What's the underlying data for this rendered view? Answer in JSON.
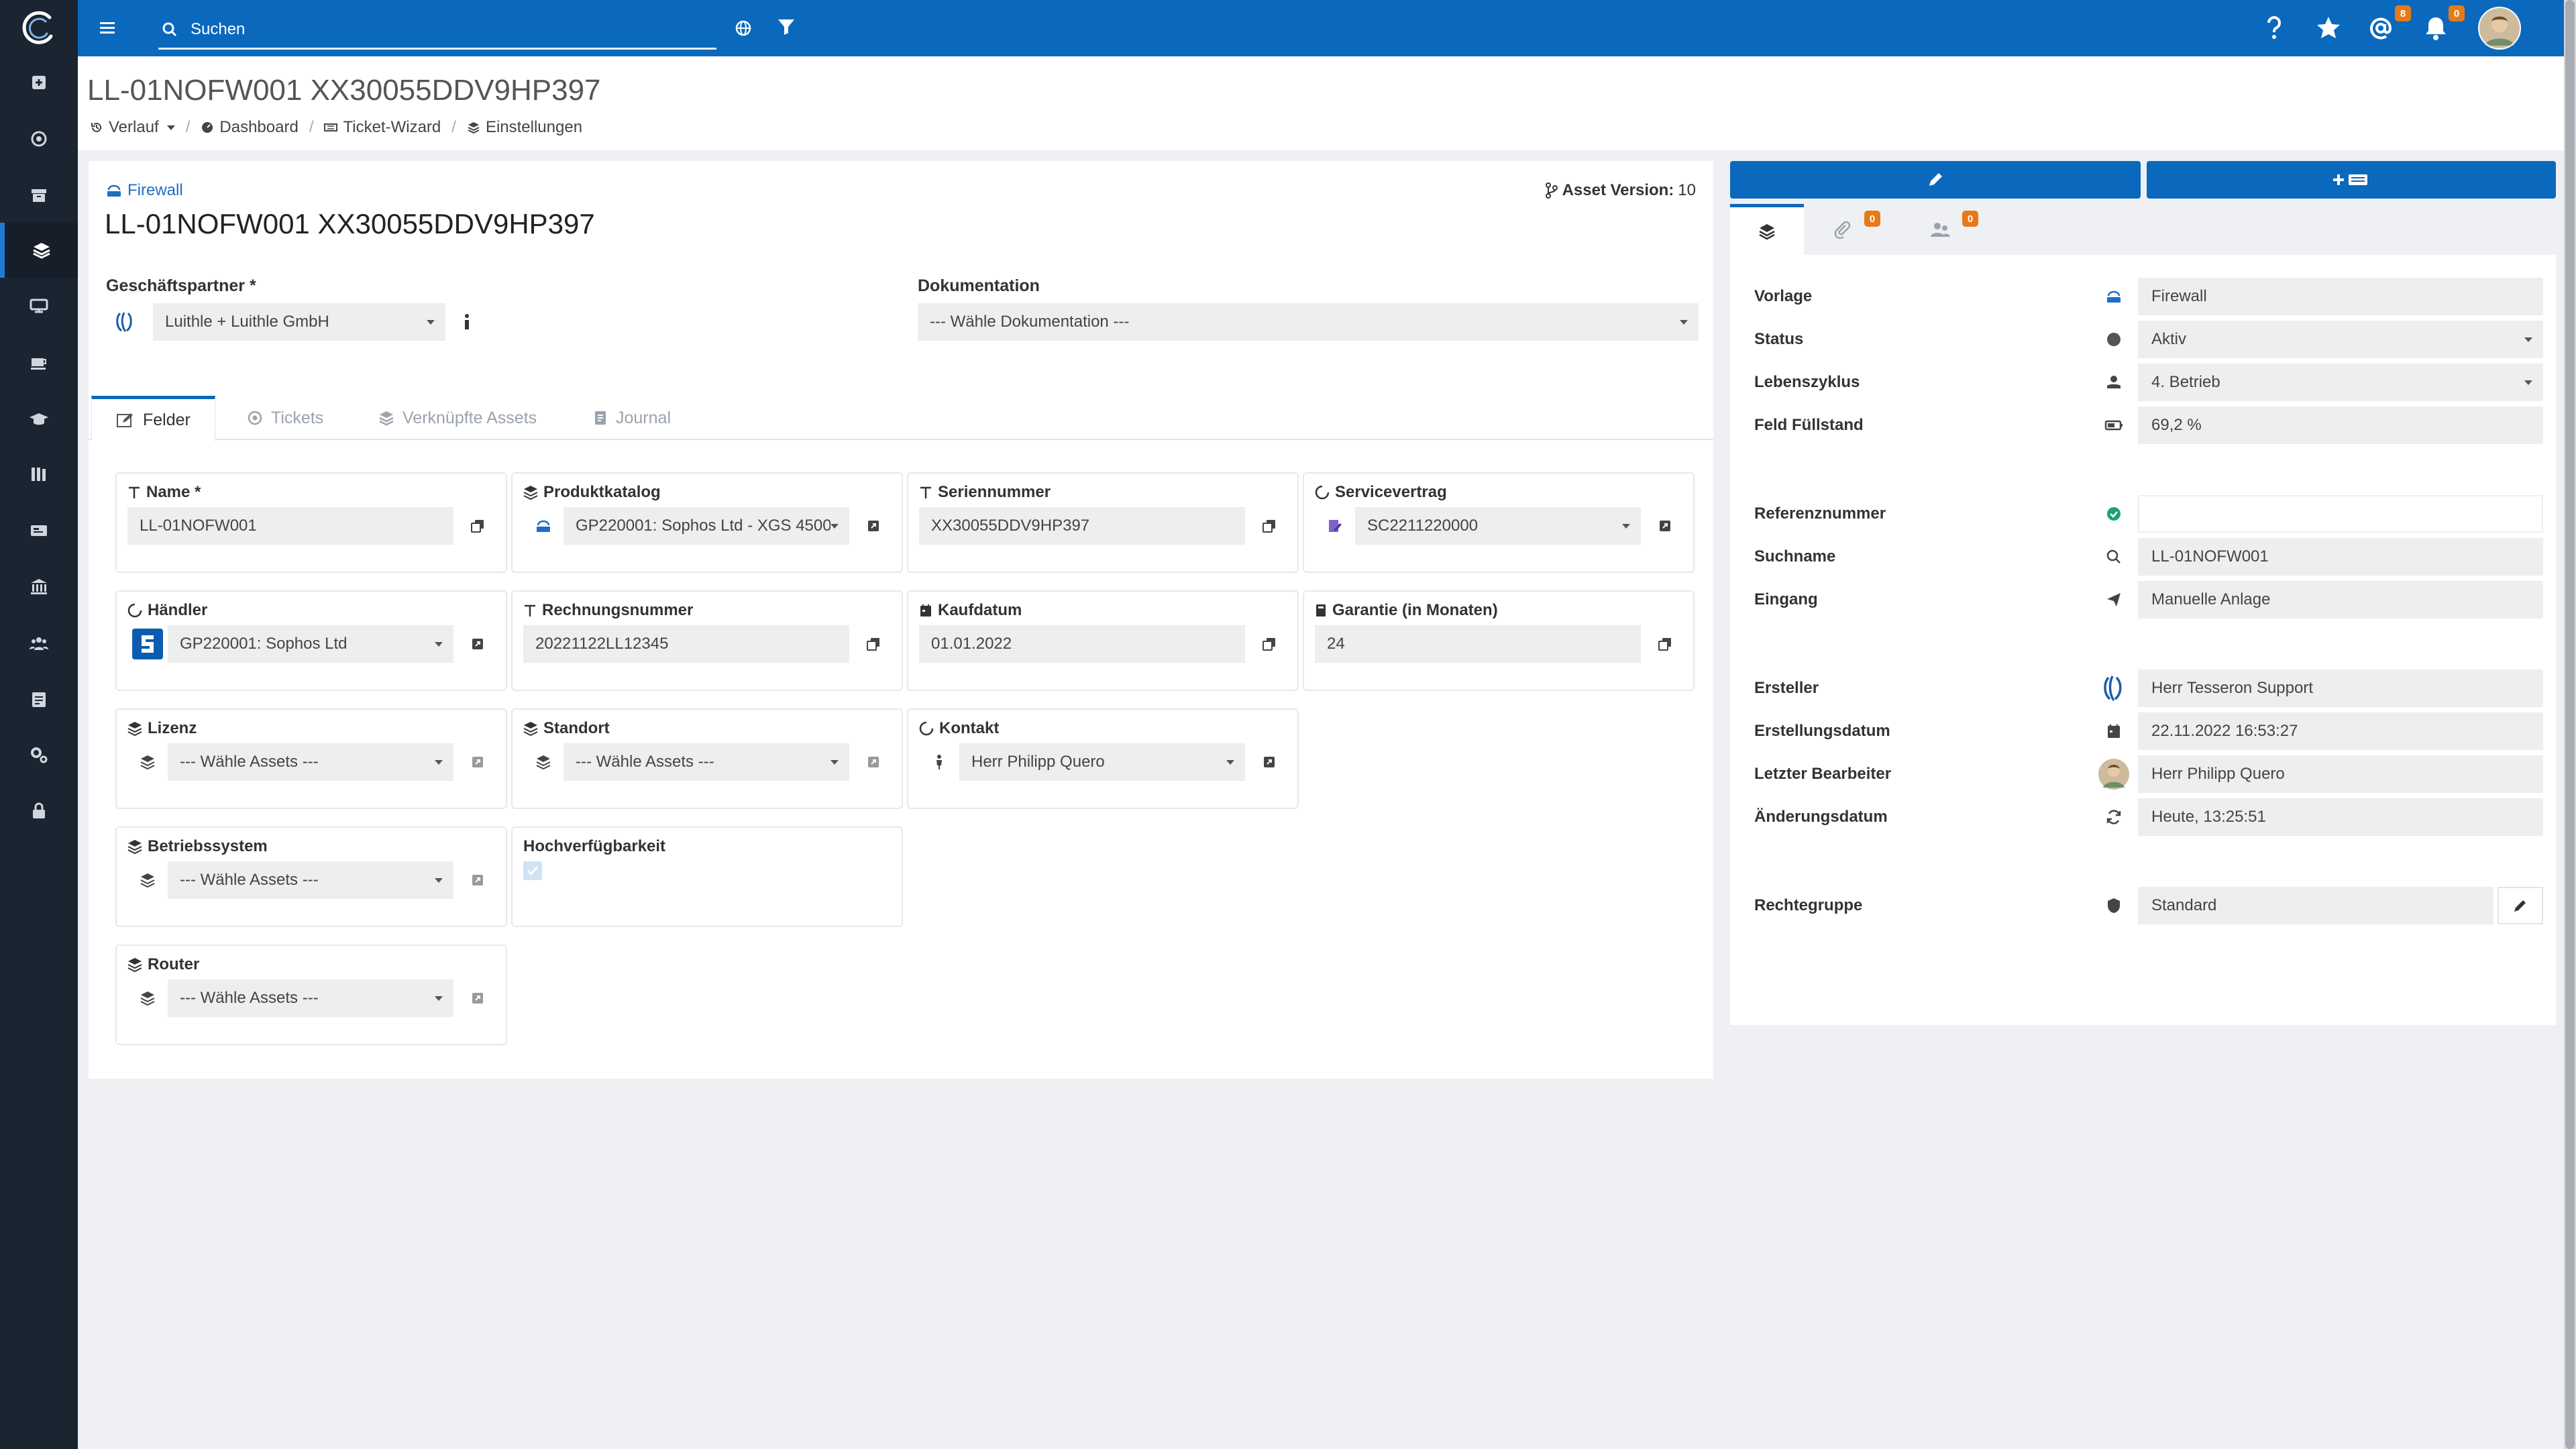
{
  "topbar": {
    "search_placeholder": "Suchen",
    "mentions_count": "8",
    "notifications_count": "0"
  },
  "header": {
    "title": "LL-01NOFW001 XX30055DDV9HP397",
    "breadcrumb": [
      "Verlauf",
      "Dashboard",
      "Ticket-Wizard",
      "Einstellungen"
    ]
  },
  "asset": {
    "type_label": "Firewall",
    "title": "LL-01NOFW001 XX30055DDV9HP397",
    "version_label": "Asset Version:",
    "version_value": "10",
    "partner_label": "Geschäftspartner *",
    "partner_value": "Luithle + Luithle GmbH",
    "doc_label": "Dokumentation",
    "doc_value": "--- Wähle Dokumentation ---"
  },
  "tabs": [
    "Felder",
    "Tickets",
    "Verknüpfte Assets",
    "Journal"
  ],
  "fields": [
    {
      "label": "Name *",
      "value": "LL-01NOFW001"
    },
    {
      "label": "Produktkatalog",
      "value": "GP220001: Sophos Ltd - XGS 4500"
    },
    {
      "label": "Seriennummer",
      "value": "XX30055DDV9HP397"
    },
    {
      "label": "Servicevertrag",
      "value": "SC2211220000"
    },
    {
      "label": "Händler",
      "value": "GP220001: Sophos Ltd"
    },
    {
      "label": "Rechnungsnummer",
      "value": "20221122LL12345"
    },
    {
      "label": "Kaufdatum",
      "value": "01.01.2022"
    },
    {
      "label": "Garantie (in Monaten)",
      "value": "24"
    },
    {
      "label": "Lizenz",
      "value": "--- Wähle Assets ---"
    },
    {
      "label": "Standort",
      "value": "--- Wähle Assets ---"
    },
    {
      "label": "Kontakt",
      "value": "Herr Philipp Quero"
    },
    {
      "label": "Betriebssystem",
      "value": "--- Wähle Assets ---"
    },
    {
      "label": "Hochverfügbarkeit",
      "value": ""
    },
    {
      "label": "Router",
      "value": "--- Wähle Assets ---"
    }
  ],
  "right_tabs": {
    "attachments_count": "0",
    "contacts_count": "0"
  },
  "properties": [
    {
      "label": "Vorlage",
      "value": "Firewall"
    },
    {
      "label": "Status",
      "value": "Aktiv"
    },
    {
      "label": "Lebenszyklus",
      "value": "4. Betrieb"
    },
    {
      "label": "Feld Füllstand",
      "value": "69,2 %"
    },
    {
      "label": "Referenznummer",
      "value": ""
    },
    {
      "label": "Suchname",
      "value": "LL-01NOFW001"
    },
    {
      "label": "Eingang",
      "value": "Manuelle Anlage"
    },
    {
      "label": "Ersteller",
      "value": "Herr Tesseron Support"
    },
    {
      "label": "Erstellungsdatum",
      "value": "22.11.2022 16:53:27"
    },
    {
      "label": "Letzter Bearbeiter",
      "value": "Herr Philipp Quero"
    },
    {
      "label": "Änderungsdatum",
      "value": "Heute, 13:25:51"
    },
    {
      "label": "Rechtegruppe",
      "value": "Standard"
    }
  ],
  "colors": {
    "brand_blue": "#0a69bd",
    "sidebar": "#1b2431",
    "badge_orange": "#e77a18",
    "status_green": "#1aa36f"
  }
}
